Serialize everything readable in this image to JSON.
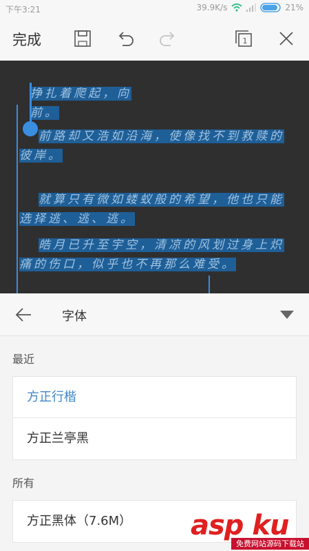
{
  "status": {
    "time": "下午3:21",
    "network_speed": "39.9K/s",
    "battery": "21%"
  },
  "toolbar": {
    "done_label": "完成"
  },
  "document": {
    "paragraphs": [
      "挣扎着爬起，向前。",
      "前路却又浩如沿海，使像找不到救赎的彼岸。",
      "就算只有微如蝼蚁般的希望，他也只能选择逃、逃、逃。",
      "皓月已升至宇空，清凉的风划过身上炽痛的伤口，似乎也不再那么难受。"
    ]
  },
  "font_panel": {
    "title": "字体",
    "recent_label": "最近",
    "recent_fonts": [
      "方正行楷",
      "方正兰亭黑"
    ],
    "all_label": "所有",
    "all_fonts": [
      "方正黑体（7.6M）"
    ]
  },
  "watermark": {
    "logo": "asp ku",
    "caption": "免费网站源码下载站"
  },
  "colors": {
    "accent": "#3a8ee0",
    "selection": "#1f5f98",
    "editor_bg": "#2f2f2f",
    "active_font": "#3d87c9"
  }
}
